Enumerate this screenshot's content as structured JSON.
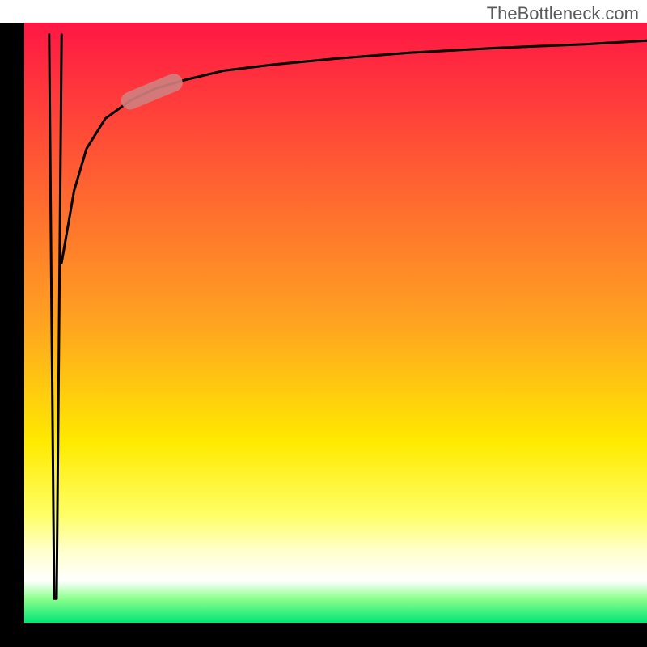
{
  "attribution": "TheBottleneck.com",
  "chart_data": {
    "type": "line",
    "title": "",
    "xlabel": "",
    "ylabel": "",
    "xlim": [
      0,
      100
    ],
    "ylim": [
      0,
      100
    ],
    "grid": false,
    "legend": false,
    "frame": {
      "left_border": true,
      "right_border": false,
      "top_border": false,
      "bottom_border": true,
      "border_color": "#000000",
      "border_width": 30
    },
    "background_gradient": {
      "type": "vertical",
      "stops": [
        {
          "offset": 0.0,
          "color": "#ff1744"
        },
        {
          "offset": 0.5,
          "color": "#ffa321"
        },
        {
          "offset": 0.7,
          "color": "#ffea00"
        },
        {
          "offset": 0.82,
          "color": "#ffff66"
        },
        {
          "offset": 0.88,
          "color": "#ffffcc"
        },
        {
          "offset": 0.93,
          "color": "#ffffff"
        },
        {
          "offset": 0.96,
          "color": "#8cff8c"
        },
        {
          "offset": 1.0,
          "color": "#00e676"
        }
      ]
    },
    "series": [
      {
        "name": "spike",
        "description": "Near-vertical spike just right of the y-axis, from top down to near the x-axis and back up",
        "x": [
          4.0,
          4.4,
          4.8,
          5.2,
          5.6,
          6.0
        ],
        "y": [
          98,
          50,
          4,
          4,
          50,
          98
        ],
        "color": "#000000",
        "width": 3
      },
      {
        "name": "log-curve",
        "description": "Monotone curve rising steeply from lower-left region toward the top then flattening to the right edge",
        "x": [
          6,
          8,
          10,
          13,
          17,
          21,
          26,
          32,
          40,
          50,
          62,
          76,
          90,
          100
        ],
        "y": [
          60,
          72,
          79,
          84,
          87,
          89,
          90.5,
          92,
          93,
          94,
          95,
          95.8,
          96.4,
          97
        ],
        "color": "#000000",
        "width": 3
      }
    ],
    "highlight": {
      "description": "Short thick muted-red segment overlaid on the log-curve near the upper-left bend",
      "x": [
        17,
        24
      ],
      "y": [
        87,
        90
      ],
      "color": "#d08080",
      "width": 22,
      "opacity": 0.9
    }
  }
}
